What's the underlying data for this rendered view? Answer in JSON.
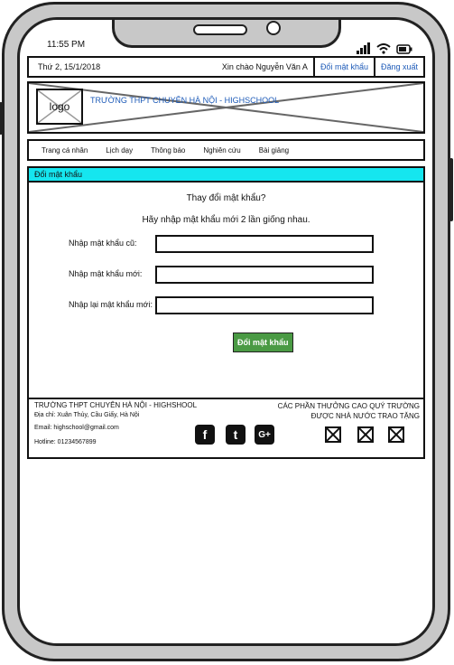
{
  "status_bar": {
    "time": "11:55 PM"
  },
  "top_bar": {
    "date": "Thứ 2, 15/1/2018",
    "greeting": "Xin chào Nguyễn Văn A",
    "change_password_link": "Đổi mật khẩu",
    "logout_link": "Đăng xuất"
  },
  "header": {
    "logo_text": "logo",
    "site_title": "TRƯỜNG THPT CHUYÊN HÀ NỘI - HIGHSCHOOL"
  },
  "nav": {
    "items": [
      "Trang cá nhân",
      "Lịch dạy",
      "Thông báo",
      "Nghiên cứu",
      "Bài giảng"
    ]
  },
  "subheader": {
    "title": "Đổi mật khẩu"
  },
  "form": {
    "question": "Thay đổi mật khẩu?",
    "hint": "Hãy nhập mật khẩu mới 2 lần giống nhau.",
    "old_label": "Nhập mật khẩu cũ:",
    "new_label": "Nhập mật khẩu mới:",
    "confirm_label": "Nhập lại mật khẩu mới:",
    "submit_label": "Đổi mật khẩu"
  },
  "footer": {
    "school": "TRƯỜNG THPT CHUYÊN HÀ NỘI - HIGHSHOOL",
    "address": "Địa chỉ: Xuân Thủy, Cầu Giấy, Hà Nội",
    "email": "Email: highschool@gmail.com",
    "hotline": "Hotline: 01234567899",
    "awards_line1": "CÁC PHẦN THƯỞNG CAO QUÝ TRƯỜNG",
    "awards_line2": "ĐƯỢC NHÀ NƯỚC TRAO TẶNG",
    "social": {
      "facebook": "f",
      "tumblr": "t",
      "google_plus": "G+"
    }
  }
}
